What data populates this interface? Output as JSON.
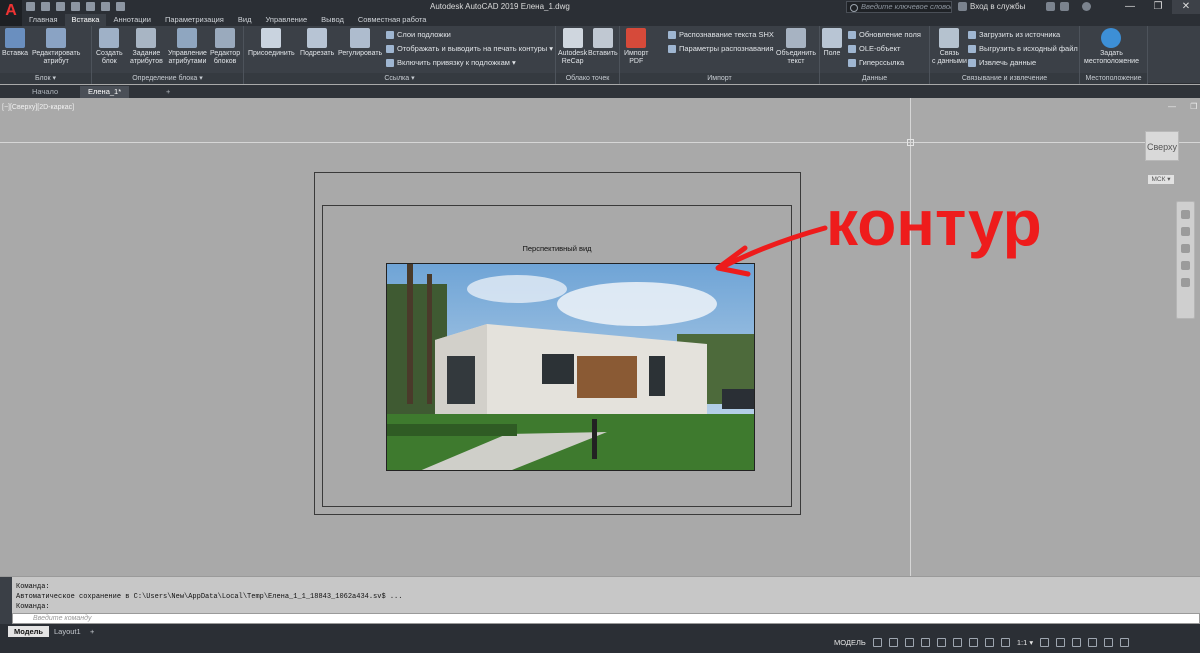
{
  "app": {
    "logo": "A",
    "title": "Autodesk AutoCAD 2019    Елена_1.dwg",
    "search_placeholder": "Введите ключевое слово/фразу",
    "login": "Вход в службы",
    "window_controls": [
      "—",
      "❐",
      "✕"
    ]
  },
  "tabs": [
    "Главная",
    "Вставка",
    "Аннотации",
    "Параметризация",
    "Вид",
    "Управление",
    "Вывод",
    "Совместная работа"
  ],
  "ribbon": {
    "block": {
      "insert": "Вставка",
      "edit_attr": "Редактировать\nатрибут",
      "title": "Блок ▾"
    },
    "block_def": {
      "create": "Создать\nблок",
      "define_attr": "Задание\nатрибутов",
      "manage_attr": "Управление\nатрибутами",
      "block_editor": "Редактор\nблоков",
      "title": "Определение блока ▾"
    },
    "reference": {
      "attach": "Присоединить",
      "clip": "Подрезать",
      "adjust": "Регулировать",
      "underlay_layers": "Слои подложки",
      "display_frames": "Отображать и выводить на печать контуры ▾",
      "snap_underlay": "Включить привязку к подложкам ▾",
      "title": "Ссылка ▾"
    },
    "pointcloud": {
      "recap": "Autodesk\nReCap",
      "insert": "Вставить",
      "title": "Облако точек"
    },
    "import": {
      "pdf": "Импорт\nPDF",
      "shx": "Распознавание текста SHX",
      "settings": "Параметры распознавания",
      "combine": "Объединить\nтекст",
      "title": "Импорт"
    },
    "data": {
      "field": "Поле",
      "update_fields": "Обновление поля",
      "ole": "OLE-объект",
      "hyperlink": "Гиперссылка",
      "title": "Данные"
    },
    "linking": {
      "link": "Связь\nс данными",
      "download": "Загрузить из источника",
      "upload": "Выгрузить в исходный файл",
      "extract": "Извлечь данные",
      "title": "Связывание и извлечение"
    },
    "location": {
      "set": "Задать\nместоположение",
      "title": "Местоположение"
    }
  },
  "doc_tabs": [
    "Начало",
    "Елена_1*",
    "+"
  ],
  "viewport": {
    "label": "[−][Сверху][2D-каркас]",
    "controls": "— ❐ ✕",
    "vp_title": "Перспективный вид",
    "viewcube": "Сверху",
    "wcs": "МСК ▾"
  },
  "annotation": "контур",
  "command": {
    "line1": "Команда:",
    "line2": "Автоматическое сохранение в C:\\Users\\New\\AppData\\Local\\Temp\\Елена_1_1_18843_1062a434.sv$ ...",
    "line3": "Команда:",
    "placeholder": "Введите команду"
  },
  "layout_tabs": [
    "Модель",
    "Layout1",
    "+"
  ],
  "status": {
    "model": "МОДЕЛЬ",
    "scale": "1:1 ▾"
  }
}
